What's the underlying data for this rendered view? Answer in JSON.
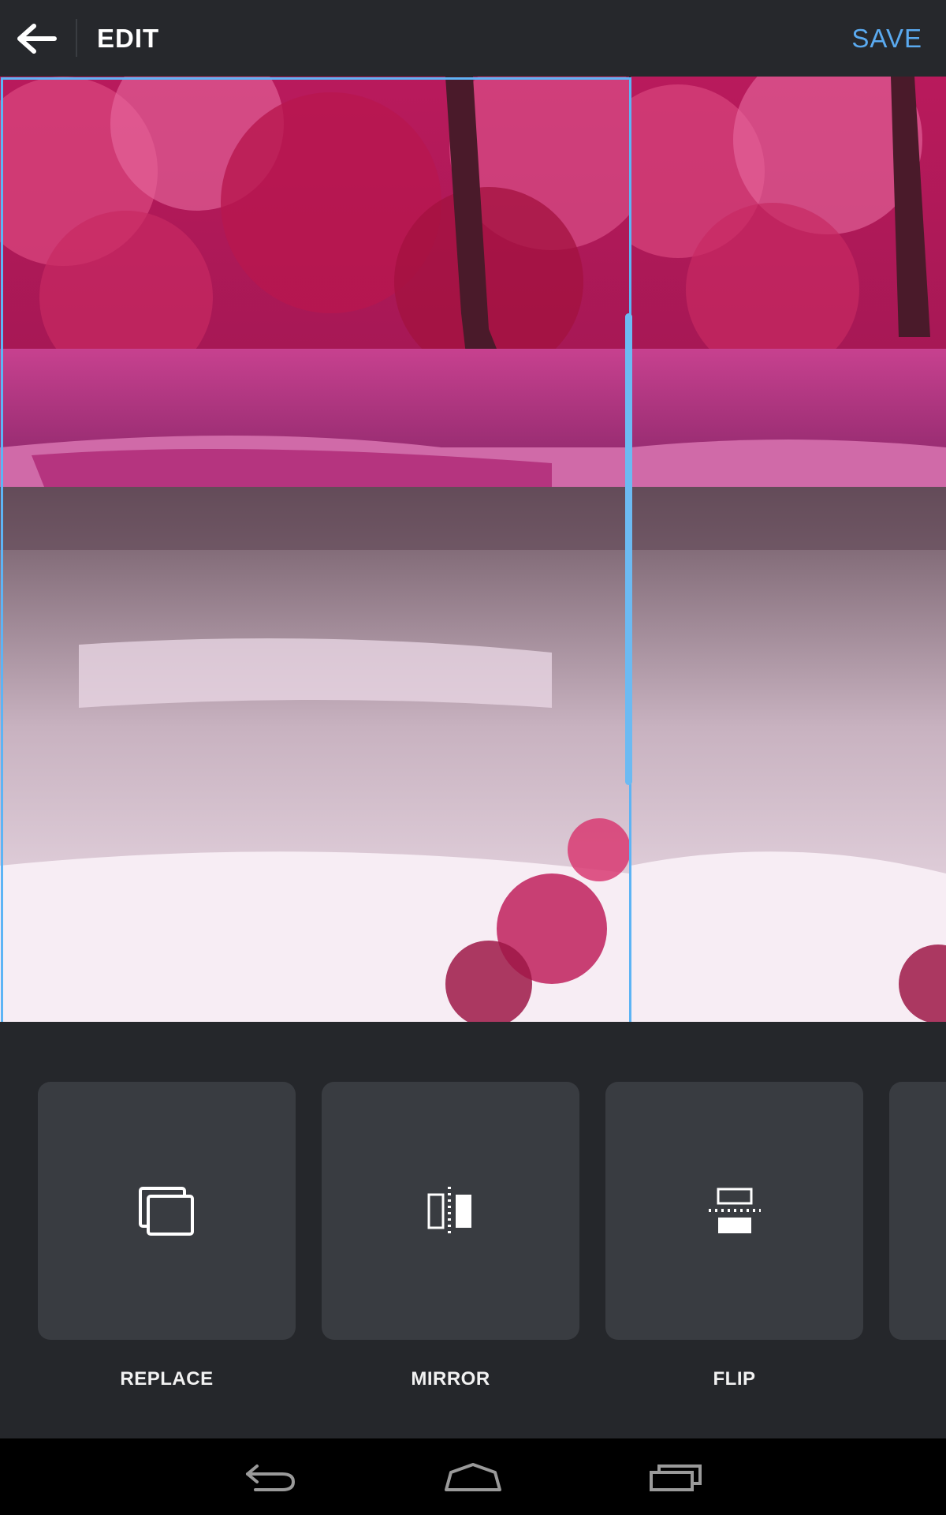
{
  "app_bar": {
    "back_icon": "arrow-back-icon",
    "title": "EDIT",
    "save_label": "SAVE",
    "accent_color": "#5aaaf0"
  },
  "canvas": {
    "image_subject": "pink forest waterfall photo",
    "selected_tile": "left",
    "selection_color": "#5db4f5"
  },
  "tools": [
    {
      "label": "REPLACE",
      "icon": "replace-icon"
    },
    {
      "label": "MIRROR",
      "icon": "mirror-icon"
    },
    {
      "label": "FLIP",
      "icon": "flip-icon"
    },
    {
      "label": "",
      "icon": "more-tool-partial"
    }
  ],
  "navbar": {
    "buttons": [
      "back-nav-icon",
      "home-nav-icon",
      "recents-nav-icon"
    ]
  }
}
